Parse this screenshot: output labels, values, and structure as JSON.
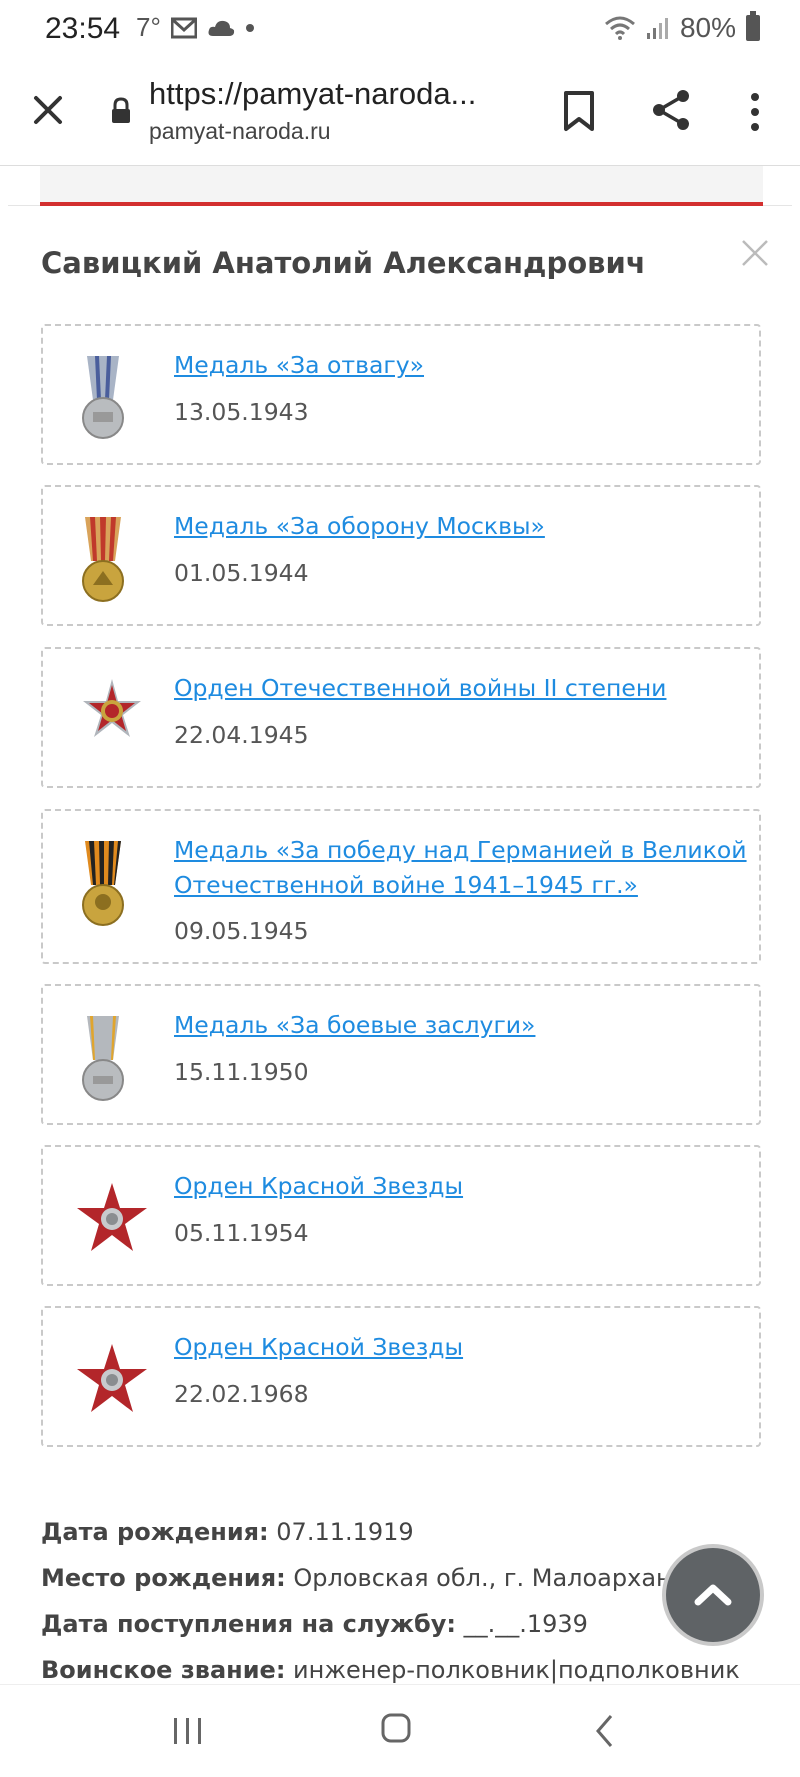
{
  "status_bar": {
    "time": "23:54",
    "temperature": "7°",
    "battery_percent": "80%"
  },
  "browser": {
    "url_display": "https://pamyat-naroda...",
    "domain": "pamyat-naroda.ru"
  },
  "person": {
    "name": "Савицкий Анатолий Александрович"
  },
  "awards": [
    {
      "title": "Медаль «За отвагу»",
      "date": "13.05.1943",
      "icon": "medal-bravery-icon"
    },
    {
      "title": "Медаль «За оборону Москвы»",
      "date": "01.05.1944",
      "icon": "medal-defense-moscow-icon"
    },
    {
      "title": "Орден Отечественной войны II степени",
      "date": "22.04.1945",
      "icon": "order-patriotic-war-icon"
    },
    {
      "title": "Медаль «За победу над Германией в Великой Отечественной войне 1941–1945 гг.»",
      "date": "09.05.1945",
      "icon": "medal-victory-germany-icon"
    },
    {
      "title": "Медаль «За боевые заслуги»",
      "date": "15.11.1950",
      "icon": "medal-combat-merit-icon"
    },
    {
      "title": "Орден Красной Звезды",
      "date": "05.11.1954",
      "icon": "order-red-star-icon"
    },
    {
      "title": "Орден Красной Звезды",
      "date": "22.02.1968",
      "icon": "order-red-star-icon"
    }
  ],
  "bio": {
    "birth_date_label": "Дата рождения:",
    "birth_date_value": " 07.11.1919",
    "birth_place_label": "Место рождения:",
    "birth_place_value": " Орловская обл., г. Малоархангельск",
    "service_start_label": "Дата поступления на службу:",
    "service_start_value": " __.__.1939",
    "rank_label": "Воинское звание:",
    "rank_value": " инженер-полковник|подполковник"
  },
  "colors": {
    "link": "#1e8be0",
    "accent_red": "#d32f2f",
    "scroll_button": "#5f6366"
  }
}
